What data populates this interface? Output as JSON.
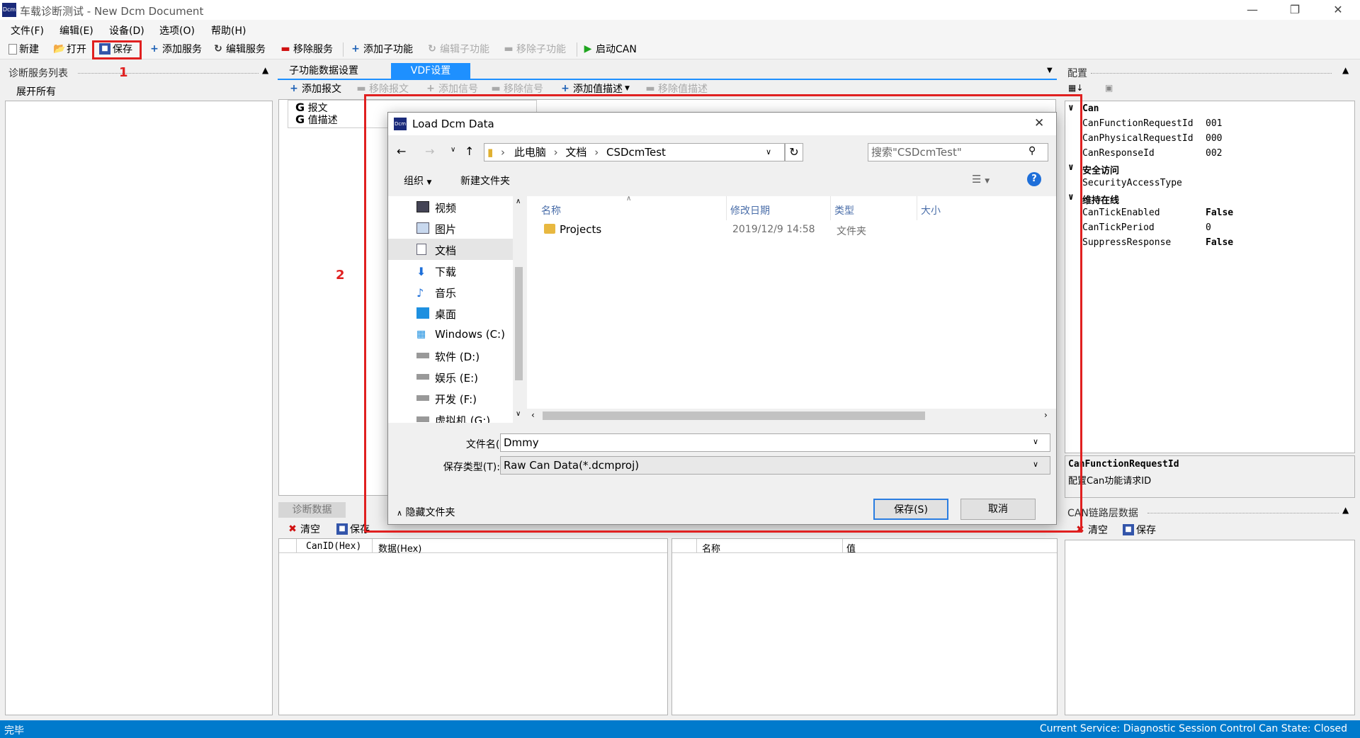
{
  "window": {
    "title": "车载诊断测试 - New Dcm Document",
    "app_icon": "Dcm"
  },
  "menu": [
    "文件(F)",
    "编辑(E)",
    "设备(D)",
    "选项(O)",
    "帮助(H)"
  ],
  "toolbar": {
    "new": "新建",
    "open": "打开",
    "save": "保存",
    "add_service": "添加服务",
    "edit_service": "编辑服务",
    "remove_service": "移除服务",
    "add_subfunc": "添加子功能",
    "edit_subfunc": "编辑子功能",
    "remove_subfunc": "移除子功能",
    "start_can": "启动CAN"
  },
  "left_panel": {
    "title": "诊断服务列表",
    "expand_all": "展开所有"
  },
  "center": {
    "tabs": [
      "子功能数据设置",
      "VDF设置"
    ],
    "toolbar": [
      "添加报文",
      "移除报文",
      "添加信号",
      "移除信号",
      "添加值描述",
      "移除值描述"
    ],
    "tree": [
      "报文",
      "值描述"
    ]
  },
  "bottom": {
    "tab": "诊断数据",
    "clear": "清空",
    "save": "保存",
    "left_cols": [
      "CanID(Hex)",
      "数据(Hex)"
    ],
    "right_cols": [
      "名称",
      "值"
    ]
  },
  "config": {
    "title": "配置",
    "categories": [
      {
        "name": "Can",
        "props": [
          {
            "key": "CanFunctionRequestId",
            "value": "001"
          },
          {
            "key": "CanPhysicalRequestId",
            "value": "000"
          },
          {
            "key": "CanResponseId",
            "value": "002"
          }
        ]
      },
      {
        "name": "安全访问",
        "props": [
          {
            "key": "SecurityAccessType",
            "value": ""
          }
        ]
      },
      {
        "name": "维持在线",
        "props": [
          {
            "key": "CanTickEnabled",
            "value": "False"
          },
          {
            "key": "CanTickPeriod",
            "value": "0"
          },
          {
            "key": "SuppressResponse",
            "value": "False"
          }
        ]
      }
    ],
    "desc_title": "CanFunctionRequestId",
    "desc_text": "配置Can功能请求ID"
  },
  "can_panel": {
    "title": "CAN链路层数据",
    "clear": "清空",
    "save": "保存"
  },
  "annotations": {
    "one": "1",
    "two": "2"
  },
  "dialog": {
    "title": "Load Dcm Data",
    "breadcrumb": [
      "此电脑",
      "文档",
      "CSDcmTest"
    ],
    "search_placeholder": "搜索\"CSDcmTest\"",
    "organize": "组织",
    "new_folder": "新建文件夹",
    "nav": [
      "视频",
      "图片",
      "文档",
      "下载",
      "音乐",
      "桌面",
      "Windows (C:)",
      "软件 (D:)",
      "娱乐 (E:)",
      "开发 (F:)",
      "虚拟机 (G:)"
    ],
    "columns": [
      "名称",
      "修改日期",
      "类型",
      "大小"
    ],
    "files": [
      {
        "name": "Projects",
        "date": "2019/12/9 14:58",
        "type": "文件夹"
      }
    ],
    "filename_label": "文件名(N):",
    "filename_value": "Dmmy",
    "filetype_label": "保存类型(T):",
    "filetype_value": "Raw Can Data(*.dcmproj)",
    "hide_folders": "隐藏文件夹",
    "save_btn": "保存(S)",
    "cancel_btn": "取消"
  },
  "status": {
    "left": "完毕",
    "right": "Current Service: Diagnostic Session Control  Can State: Closed"
  },
  "colors": {
    "accent": "#1e90ff",
    "status_bar": "#007acc",
    "annotation": "#e02020"
  }
}
